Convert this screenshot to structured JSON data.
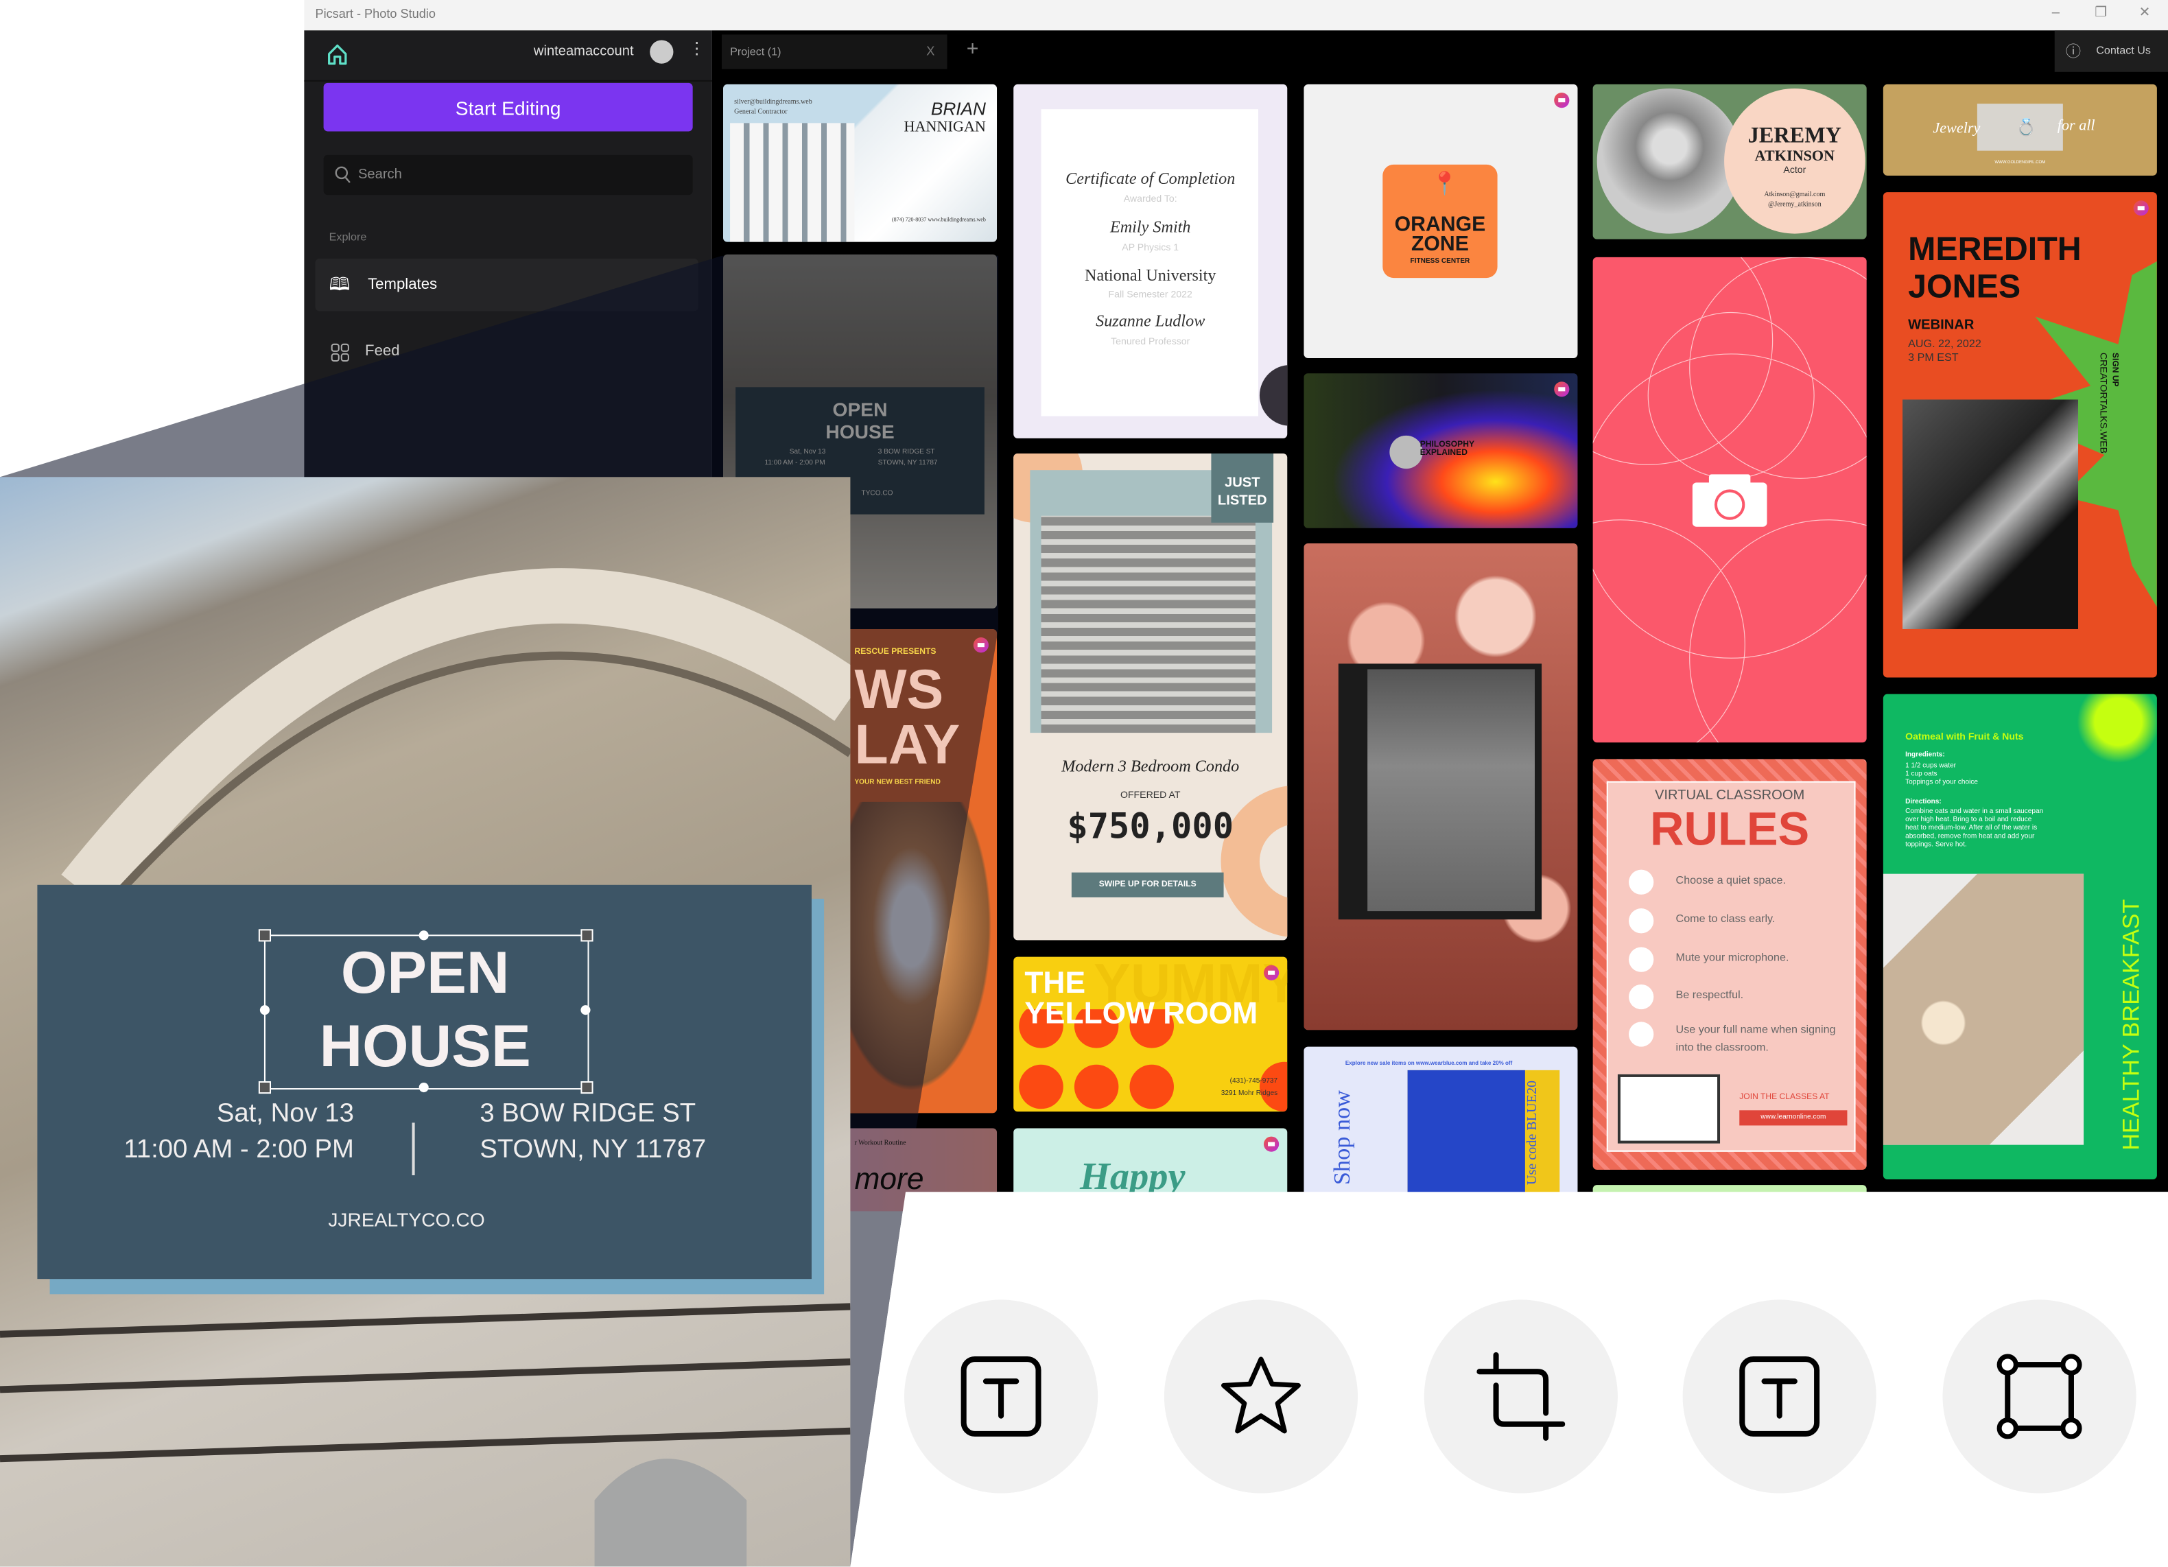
{
  "window": {
    "title": "Picsart - Photo Studio",
    "minimize": "–",
    "restore": "❐",
    "close": "✕"
  },
  "sidebar": {
    "username": "winteamaccount",
    "start_editing": "Start Editing",
    "search_placeholder": "Search",
    "explore_label": "Explore",
    "items": [
      {
        "label": "Templates",
        "icon": "book-icon",
        "active": true
      },
      {
        "label": "Feed",
        "icon": "grid-icon",
        "active": false
      }
    ]
  },
  "tabs": {
    "project": "Project (1)",
    "close": "X",
    "add": "+"
  },
  "header": {
    "contact": "Contact Us"
  },
  "colors": {
    "accent": "#7b35f0",
    "sidebar": "#1c1c1e",
    "grid": "#000000",
    "poster": "#3d5566",
    "poster_shadow": "#76a9c4"
  },
  "templates": {
    "brian": {
      "first": "BRIAN",
      "last": "HANNIGAN",
      "email": "silver@buildingdreams.web",
      "role": "General Contractor",
      "phone": "(874) 720-8037 www.buildingdreams.web"
    },
    "open_small": {
      "title1": "OPEN",
      "title2": "HOUSE",
      "date": "Sat, Nov 13",
      "time": "11:00 AM - 2:00 PM",
      "addr1": "3 BOW RIDGE ST",
      "addr2": "STOWN, NY 11787",
      "site": "TYCO.CO"
    },
    "paws": {
      "presents": "RESCUE PRESENTS",
      "t1": "WS",
      "t2": "LAY",
      "sub": "YOUR NEW BEST FRIEND"
    },
    "more": {
      "top": "r Workout Routine",
      "big": "more"
    },
    "certificate": {
      "title": "Certificate of Completion",
      "awarded": "Awarded To:",
      "name": "Emily Smith",
      "course": "AP Physics 1",
      "school": "National University",
      "term": "Fall Semester 2022",
      "signer": "Suzanne Ludlow",
      "signer_title": "Tenured Professor"
    },
    "listed": {
      "badge1": "JUST",
      "badge2": "LISTED",
      "desc": "Modern 3 Bedroom Condo",
      "offered": "OFFERED AT",
      "price": "$750,000",
      "cta": "SWIPE UP FOR DETAILS"
    },
    "yellow": {
      "l1": "THE",
      "l2": "YELLOW ROOM",
      "bg": "YUMMY!",
      "phone": "(431)-745-9737",
      "addr": "3291 Mohr Ridges"
    },
    "happy": {
      "text": "Happy"
    },
    "orange": {
      "l1": "ORANGE",
      "l2": "ZONE",
      "l3": "FITNESS CENTER"
    },
    "philosophy": {
      "l1": "PHILOSOPHY",
      "l2": "EXPLAINED"
    },
    "shop": {
      "top": "Explore new sale items on www.wearblue.com and take 20% off",
      "left": "Shop now",
      "right": "Use code BLUE20"
    },
    "jeremy": {
      "first": "JEREMY",
      "last": "ATKINSON",
      "role": "Actor",
      "email": "Atkinson@gmail.com",
      "insta": "@Jeremy_atkinson"
    },
    "rules": {
      "kicker": "VIRTUAL CLASSROOM",
      "title": "RULES",
      "items": [
        "Choose a quiet space.",
        "Come to class early.",
        "Mute your microphone.",
        "Be respectful.",
        "Use your full name when signing into the classroom."
      ],
      "join": "JOIN THE CLASSES AT",
      "url": "www.learnonline.com"
    },
    "jewelry": {
      "l": "Jewelry",
      "r": "for all",
      "url": "WWW.GOLDENGIRL.COM"
    },
    "meredith": {
      "l1": "MEREDITH",
      "l2": "JONES",
      "webinar": "WEBINAR",
      "date": "AUG. 22, 2022",
      "time": "3 PM EST",
      "signup": "SIGN UP",
      "site": "CREATORTALKS.WEB"
    },
    "breakfast": {
      "title": "Oatmeal with Fruit & Nuts",
      "ing_label": "Ingredients:",
      "ing": [
        "1 1/2 cups water",
        "1 cup oats",
        "Toppings of your choice"
      ],
      "dir_label": "Directions:",
      "dir": "Combine oats and water in a small saucepan over high heat. Bring to a boil and reduce heat to medium-low. After all of the water is absorbed, remove from heat and add your toppings. Serve hot.",
      "side": "HEALTHY BREAKFAST"
    }
  },
  "poster": {
    "title1": "OPEN",
    "title2": "HOUSE",
    "date": "Sat, Nov 13",
    "time": "11:00 AM - 2:00 PM",
    "addr1": "3 BOW RIDGE ST",
    "addr2": "STOWN, NY 11787",
    "site": "JJREALTYCO.CO"
  },
  "tools": [
    {
      "icon": "text-icon"
    },
    {
      "icon": "star-icon"
    },
    {
      "icon": "crop-icon"
    },
    {
      "icon": "text-icon"
    },
    {
      "icon": "rectangle-icon"
    }
  ]
}
